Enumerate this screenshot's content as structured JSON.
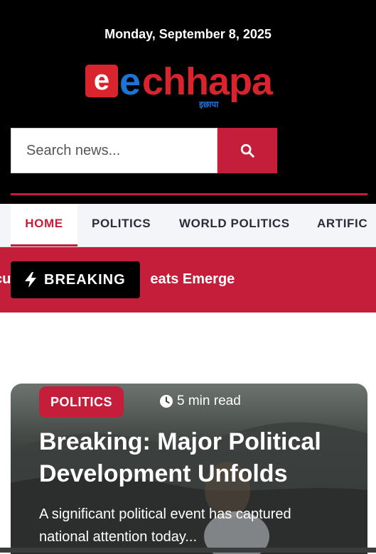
{
  "header": {
    "date": "Monday, September 8, 2025",
    "logo": {
      "mark": "e",
      "wordmark_blue": "e",
      "wordmark_red": "chhapa",
      "subtitle": "इछापा"
    },
    "search": {
      "placeholder": "Search news...",
      "button_icon": "search-icon"
    }
  },
  "nav": {
    "items": [
      {
        "label": "HOME",
        "active": true
      },
      {
        "label": "POLITICS",
        "active": false
      },
      {
        "label": "WORLD POLITICS",
        "active": false
      },
      {
        "label": "ARTIFIC",
        "active": false
      }
    ]
  },
  "breaking": {
    "badge_label": "BREAKING",
    "badge_icon": "bolt-icon",
    "ticker_text": "cu",
    "ticker_text_tail": "eats Emerge"
  },
  "featured": {
    "category": "POLITICS",
    "read_time": "5 min read",
    "read_time_icon": "clock-icon",
    "title": "Breaking: Major Political Development Unfolds",
    "excerpt": "A significant political event has captured national attention today..."
  },
  "colors": {
    "accent": "#c41e3a",
    "header_bg": "#000000",
    "logo_blue": "#1b74d6",
    "logo_red": "#d9232d",
    "nav_bg": "#f4f5f9"
  }
}
